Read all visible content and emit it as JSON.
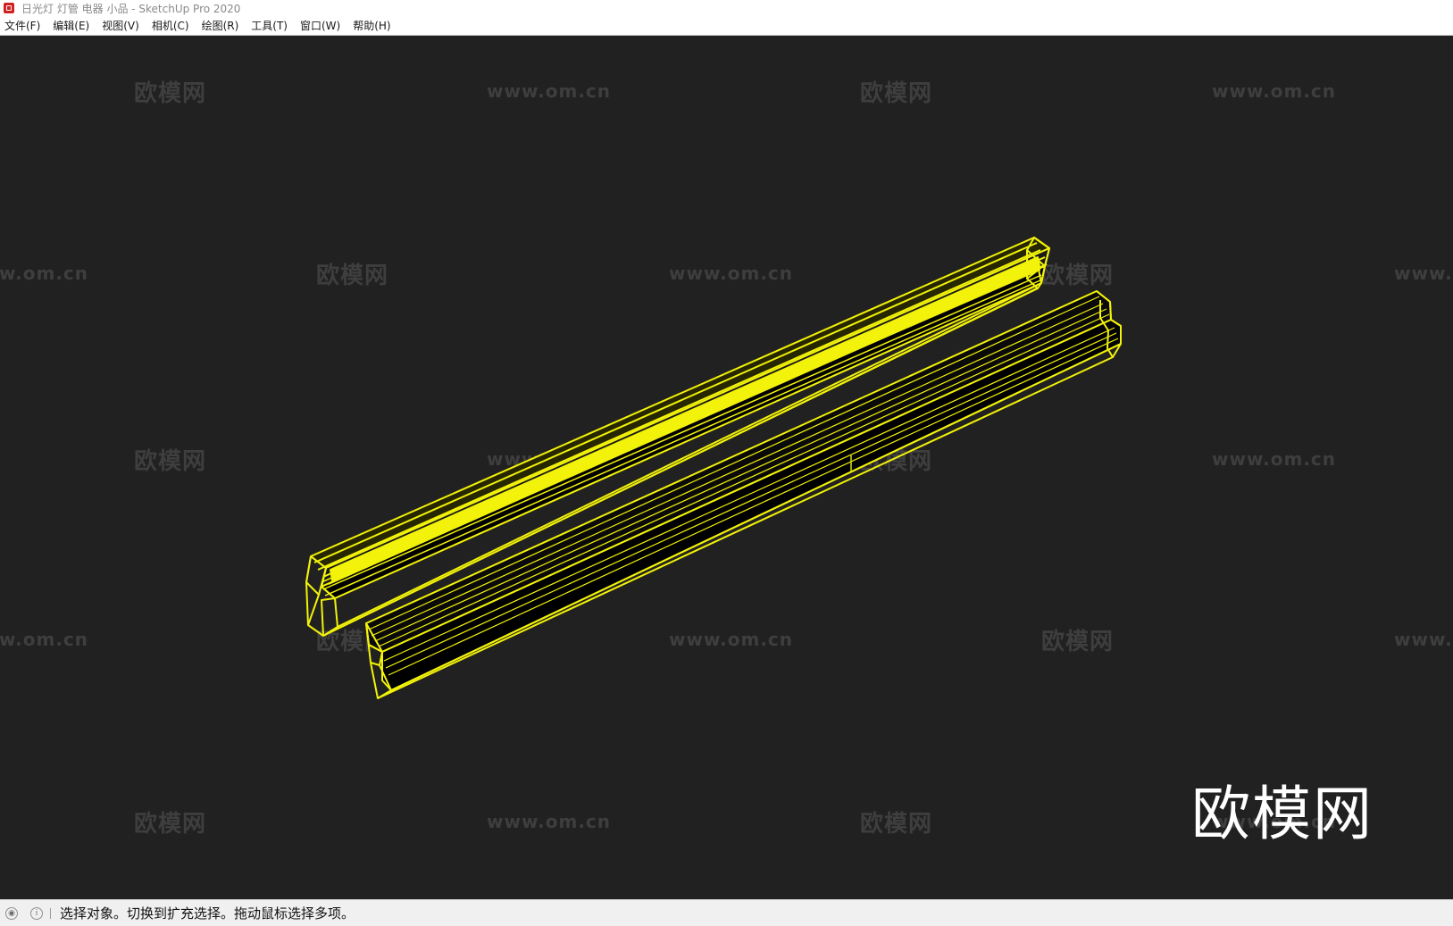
{
  "window": {
    "title": "日光灯 灯管 电器 小品 - SketchUp Pro 2020"
  },
  "menubar": {
    "items": [
      {
        "label": "文件(F)"
      },
      {
        "label": "编辑(E)"
      },
      {
        "label": "视图(V)"
      },
      {
        "label": "相机(C)"
      },
      {
        "label": "绘图(R)"
      },
      {
        "label": "工具(T)"
      },
      {
        "label": "窗口(W)"
      },
      {
        "label": "帮助(H)"
      }
    ]
  },
  "viewport": {
    "background": "#212121",
    "selection_color": "#f2f20a",
    "watermark_brand": "欧模网",
    "watermark_url": "www.om.cn",
    "logo_text": "欧模网"
  },
  "statusbar": {
    "message": "选择对象。切换到扩充选择。拖动鼠标选择多项。",
    "icons": [
      "geo-location-icon",
      "info-icon"
    ]
  }
}
